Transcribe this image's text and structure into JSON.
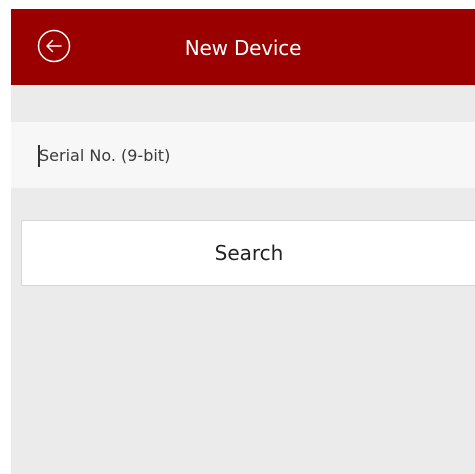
{
  "header": {
    "title": "New Device",
    "back_icon": "arrow-left-circle-icon",
    "background_color": "#9b0000",
    "text_color": "#ffffff"
  },
  "serial_field": {
    "placeholder": "Serial No. (9-bit)",
    "value": ""
  },
  "search_button": {
    "label": "Search"
  },
  "colors": {
    "page_background": "#ebebeb",
    "field_background": "#f7f7f7",
    "button_background": "#ffffff"
  }
}
